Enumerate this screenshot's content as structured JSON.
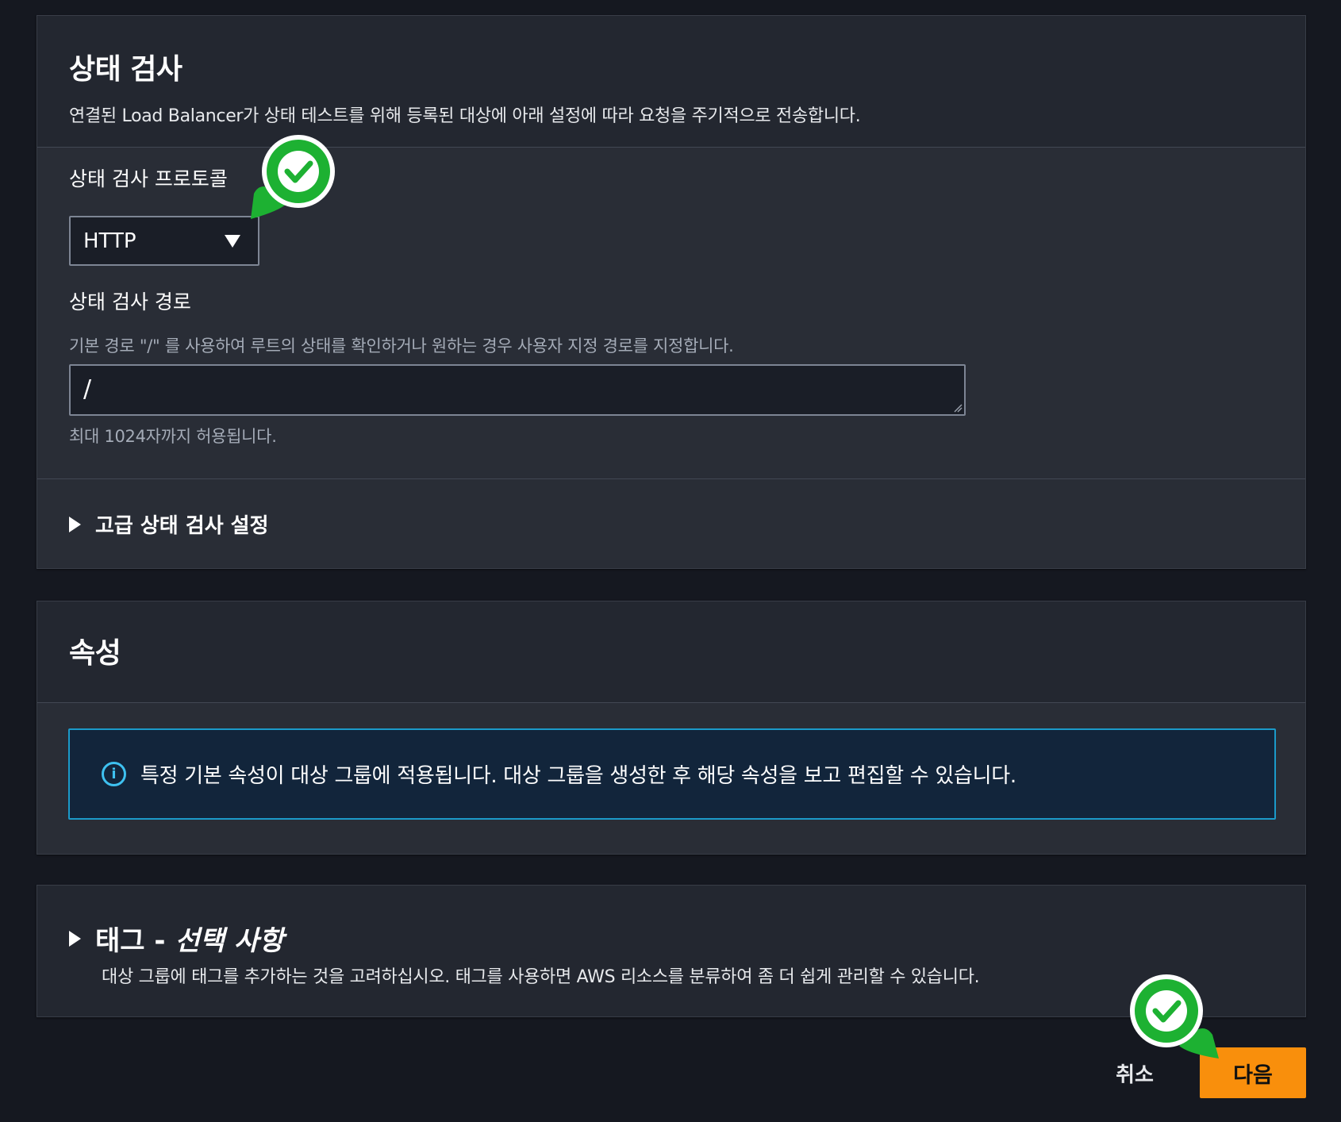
{
  "health_check": {
    "title": "상태 검사",
    "description": "연결된 Load Balancer가 상태 테스트를 위해 등록된 대상에 아래 설정에 따라 요청을 주기적으로 전송합니다.",
    "protocol_label": "상태 검사 프로토콜",
    "protocol_value": "HTTP",
    "path_label": "상태 검사 경로",
    "path_description": "기본 경로 \"/\" 를 사용하여 루트의 상태를 확인하거나 원하는 경우 사용자 지정 경로를 지정합니다.",
    "path_value": "/",
    "path_hint": "최대 1024자까지 허용됩니다.",
    "advanced_label": "고급 상태 검사 설정"
  },
  "attributes": {
    "title": "속성",
    "info_text": "특정 기본 속성이 대상 그룹에 적용됩니다. 대상 그룹을 생성한 후 해당 속성을 보고 편집할 수 있습니다."
  },
  "tags": {
    "title": "태그 -",
    "optional": "선택 사항",
    "description": "대상 그룹에 태그를 추가하는 것을 고려하십시오. 태그를 사용하면 AWS 리소스를 분류하여 좀 더 쉽게 관리할 수 있습니다."
  },
  "footer": {
    "cancel_label": "취소",
    "next_label": "다음"
  },
  "icons": {
    "info": "info-icon",
    "checkmark_pin": "checkmark-pin-icon",
    "expand": "caret-right-icon",
    "dropdown": "caret-down-icon"
  },
  "colors": {
    "background": "#151820",
    "panel": "#292d36",
    "primary_button": "#f98f0c",
    "info_border": "#1b9ac9",
    "info_background": "#12253b",
    "pin_green": "#1db132"
  }
}
